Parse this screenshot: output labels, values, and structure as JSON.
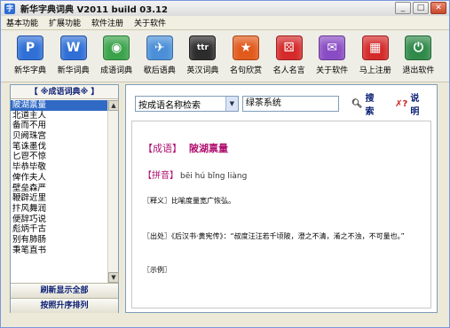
{
  "window": {
    "title": "新华字典词典 V2011 build 03.12",
    "icon": "app-icon"
  },
  "menubar": [
    "基本功能",
    "扩展功能",
    "软件注册",
    "关于软件"
  ],
  "toolbar": [
    {
      "label": "新华字典",
      "glyph": "P",
      "color": "#2f6fd6",
      "icon": "dictionary-p-icon"
    },
    {
      "label": "新华词典",
      "glyph": "W",
      "color": "#2f6fd6",
      "icon": "dictionary-w-icon"
    },
    {
      "label": "成语词典",
      "glyph": "◉",
      "color": "#3aa34a",
      "icon": "idiom-icon"
    },
    {
      "label": "歇后语典",
      "glyph": "✈",
      "color": "#4a8fd8",
      "icon": "plane-icon"
    },
    {
      "label": "英汉词典",
      "glyph": "ttr",
      "color": "#2c2c2c",
      "icon": "english-icon"
    },
    {
      "label": "名句欣赏",
      "glyph": "★",
      "color": "#e25a1c",
      "icon": "star-icon"
    },
    {
      "label": "名人名言",
      "glyph": "⚄",
      "color": "#d42a2a",
      "icon": "dice-icon"
    },
    {
      "label": "关于软件",
      "glyph": "✉",
      "color": "#8a4cc4",
      "icon": "about-icon"
    },
    {
      "label": "马上注册",
      "glyph": "▦",
      "color": "#d42a2a",
      "icon": "register-icon"
    },
    {
      "label": "退出软件",
      "glyph": "⏻",
      "color": "#2f8a4a",
      "icon": "exit-icon"
    }
  ],
  "left_panel": {
    "header": "【 ※成语词典※ 】",
    "selected_index": 0,
    "items": [
      "陂湖禀量",
      "北道主人",
      "备而不用",
      "贝阙珠宫",
      "笔诛墨伐",
      "匕鬯不惊",
      "毕恭毕敬",
      "俾作夫人",
      "壁垒森严",
      "鞭辟近里",
      "抃风舞润",
      "便辞巧说",
      "彪炳千古",
      "别有肺肠",
      "秉笔直书"
    ],
    "refresh_button": "刷新显示全部",
    "sort_button": "按照升序排列"
  },
  "search": {
    "mode_value": "按成语名称检索",
    "query_value": "绿茶系统",
    "search_label": "搜索",
    "help_label": "说明"
  },
  "entry": {
    "tag": "【成语】",
    "idiom": "陂湖禀量",
    "pinyin_tag": "【拼音】",
    "pinyin": "bēi hú bǐng liàng",
    "definition": "〖释义〗比喻度量宽广恢弘。",
    "source": "〖出处〗《后汉书·黄宪传》：“叔度汪汪若千顷陂，澄之不清，淆之不浊，不可量也。”",
    "example": "〖示例〗"
  }
}
